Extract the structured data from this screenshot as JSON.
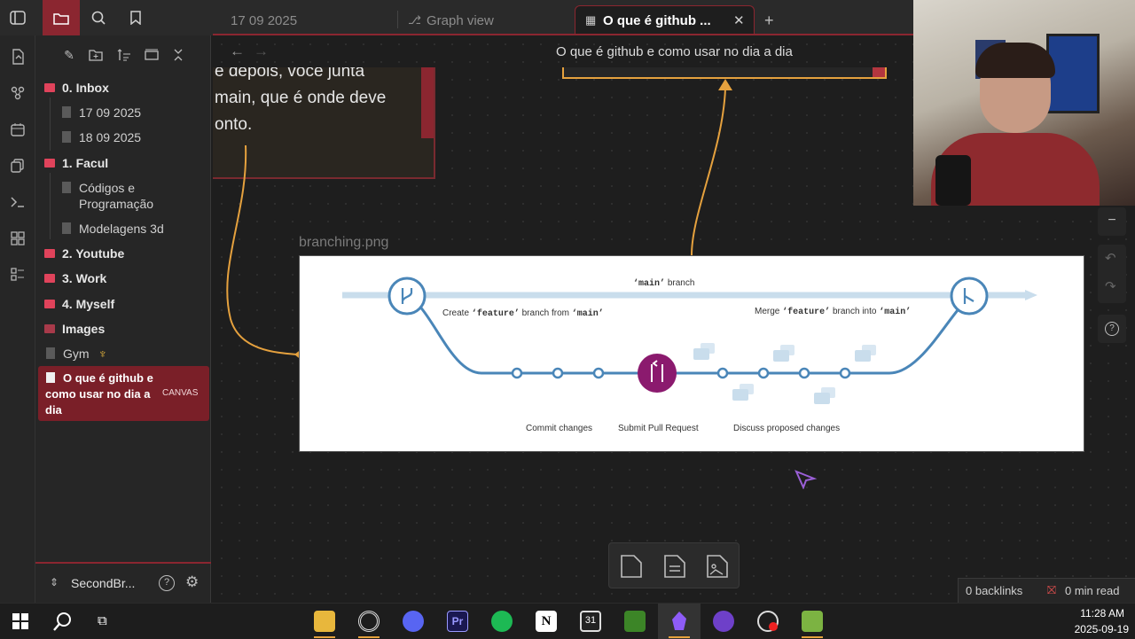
{
  "tabs": {
    "tab1_label": "17 09 2025",
    "tab2_label": "Graph view",
    "tab3_label": "O que é github ...",
    "new_tab": "+"
  },
  "canvas": {
    "title": "O que é github e como usar no dia a dia",
    "note_lines": [
      "e depois, você junta",
      "main, que é onde deve",
      "onto."
    ],
    "image_label": "branching.png",
    "diagram": {
      "main_branch": "main",
      "main_branch_suffix": "branch",
      "create_prefix": "Create",
      "feature": "feature",
      "create_middle": "branch from",
      "merge_prefix": "Merge",
      "merge_middle": "branch into",
      "commit_label": "Commit changes",
      "pr_label": "Submit Pull Request",
      "discuss_label": "Discuss proposed changes"
    }
  },
  "sidebar": {
    "items": [
      {
        "type": "folder",
        "label": "0. Inbox"
      },
      {
        "type": "file",
        "label": "17 09 2025"
      },
      {
        "type": "file",
        "label": "18 09 2025"
      },
      {
        "type": "folder",
        "label": "1. Facul"
      },
      {
        "type": "file",
        "label": "Códigos e Programação"
      },
      {
        "type": "file",
        "label": "Modelagens 3d"
      },
      {
        "type": "folder",
        "label": "2. Youtube"
      },
      {
        "type": "folder",
        "label": "3. Work"
      },
      {
        "type": "folder",
        "label": "4. Myself"
      },
      {
        "type": "folder",
        "label": "Images"
      },
      {
        "type": "file",
        "label": "Gym"
      },
      {
        "type": "file",
        "label": "O que é github e como usar no dia a dia",
        "badge": "CANVAS",
        "active": true
      }
    ],
    "vault_name": "SecondBr..."
  },
  "status": {
    "backlinks": "0 backlinks",
    "read_time": "0 min read"
  },
  "taskbar": {
    "time": "11:28 AM",
    "date": "2025-09-19"
  },
  "colors": {
    "accent": "#8b2630",
    "edge": "#e5a13e",
    "folder": "#e0435b",
    "diagram_blue": "#4a86b8",
    "pr_purple": "#8b1a6e"
  }
}
